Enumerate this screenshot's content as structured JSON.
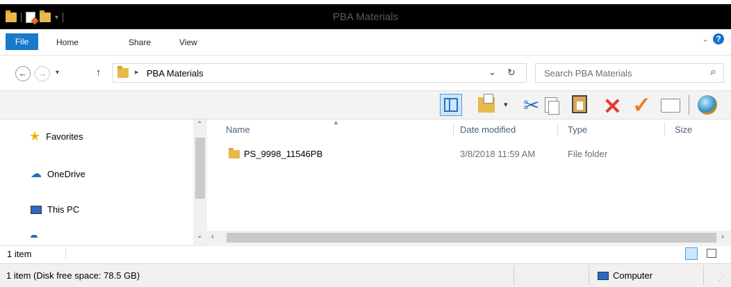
{
  "window": {
    "title": "PBA Materials"
  },
  "ribbon": {
    "tabs": [
      {
        "label": "File"
      },
      {
        "label": "Home"
      },
      {
        "label": "Share"
      },
      {
        "label": "View"
      }
    ],
    "help_label": "?"
  },
  "nav": {
    "back_glyph": "←",
    "forward_glyph": "→",
    "recent_glyph": "▾",
    "up_glyph": "↑",
    "breadcrumb_sep": "▸",
    "path": "PBA Materials",
    "dropdown_glyph": "⌄",
    "refresh_glyph": "↻",
    "search_placeholder": "Search PBA Materials",
    "search_icon": "⌕"
  },
  "navpane": {
    "items": [
      {
        "label": "Favorites",
        "icon": "star-icon"
      },
      {
        "label": "OneDrive",
        "icon": "cloud-icon"
      },
      {
        "label": "This PC",
        "icon": "computer-icon"
      }
    ]
  },
  "file_list": {
    "columns": [
      "Name",
      "Date modified",
      "Type",
      "Size"
    ],
    "rows": [
      {
        "name": "PS_9998_11546PB",
        "date": "3/8/2018 11:59 AM",
        "type": "File folder",
        "size": ""
      }
    ]
  },
  "status": {
    "item_count": "1 item",
    "disk_info": "1 item (Disk free space: 78.5 GB)",
    "location": "Computer"
  },
  "colors": {
    "accent": "#1979ca",
    "folder": "#e8b84a",
    "delete": "#e23b2e",
    "check": "#f07a1a"
  }
}
